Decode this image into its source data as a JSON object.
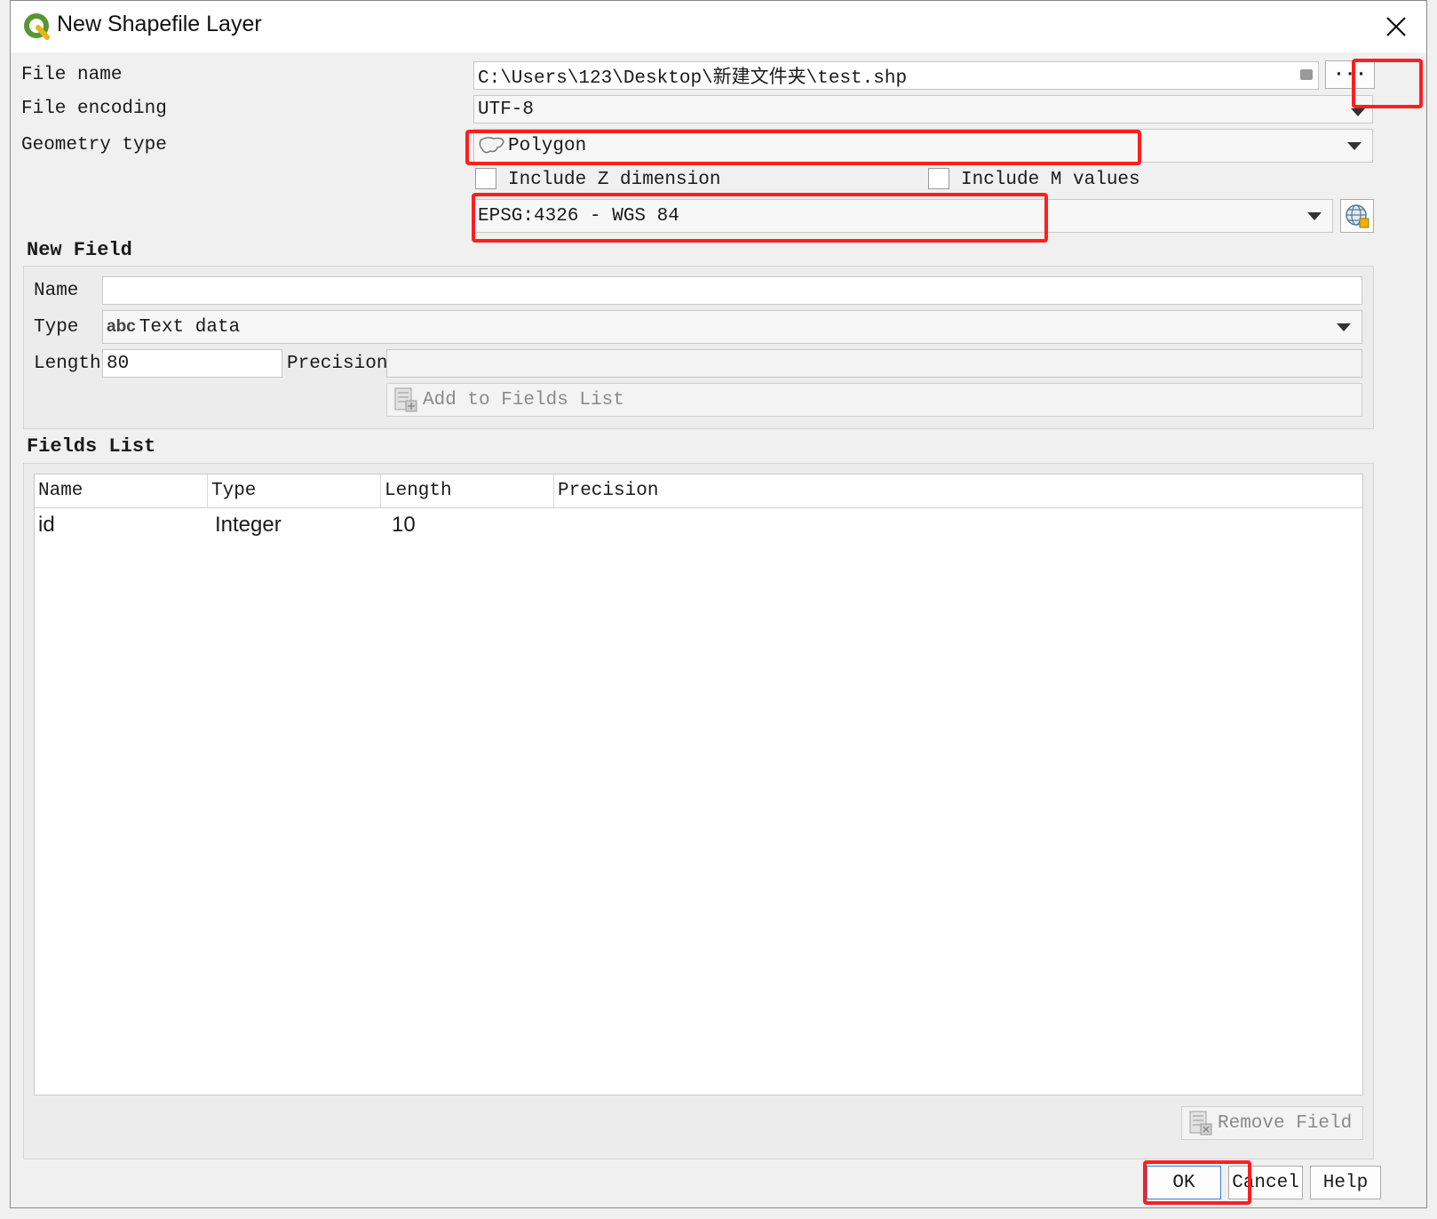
{
  "window": {
    "title": "New Shapefile Layer"
  },
  "form": {
    "file_name_label": "File name",
    "file_name_value": "C:\\Users\\123\\Desktop\\新建文件夹\\test.shp",
    "browse_label": "···",
    "file_encoding_label": "File encoding",
    "file_encoding_value": "UTF-8",
    "geometry_type_label": "Geometry type",
    "geometry_type_value": "Polygon",
    "include_z_label": "Include Z dimension",
    "include_m_label": "Include M values",
    "crs_value": "EPSG:4326 - WGS 84"
  },
  "new_field": {
    "title": "New Field",
    "name_label": "Name",
    "name_value": "",
    "type_label": "Type",
    "type_badge": "abc",
    "type_value": "Text data",
    "length_label": "Length",
    "length_value": "80",
    "precision_label": "Precision",
    "precision_value": "",
    "add_button": "Add to Fields List"
  },
  "fields_list": {
    "title": "Fields List",
    "columns": [
      "Name",
      "Type",
      "Length",
      "Precision"
    ],
    "rows": [
      [
        "id",
        "Integer",
        "10",
        ""
      ]
    ],
    "remove_button": "Remove Field"
  },
  "buttons": {
    "ok": "OK",
    "cancel": "Cancel",
    "help": "Help"
  },
  "colors": {
    "highlight": "#ff1f1f",
    "qgis_green": "#589632",
    "qgis_yellow": "#eeb211"
  }
}
